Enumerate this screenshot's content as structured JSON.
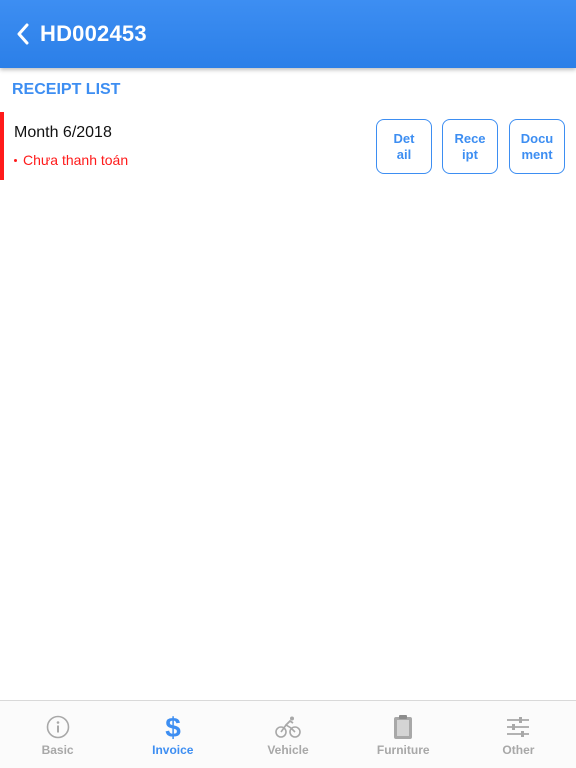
{
  "header": {
    "title": "HD002453"
  },
  "section": {
    "title": "RECEIPT LIST"
  },
  "receipts": [
    {
      "month": "Month 6/2018",
      "status": "Chưa thanh toán",
      "actions": {
        "detail": "Det\nail",
        "receipt": "Rece\nipt",
        "document": "Docu\nment"
      }
    }
  ],
  "tabs": [
    {
      "label": "Basic",
      "icon": "info-icon"
    },
    {
      "label": "Invoice",
      "icon": "dollar-icon"
    },
    {
      "label": "Vehicle",
      "icon": "bicycle-icon"
    },
    {
      "label": "Furniture",
      "icon": "clipboard-icon"
    },
    {
      "label": "Other",
      "icon": "sliders-icon"
    }
  ],
  "colors": {
    "accent": "#3d8ef2",
    "alert": "#ff1a1a",
    "inactive": "#a8a8a8"
  }
}
